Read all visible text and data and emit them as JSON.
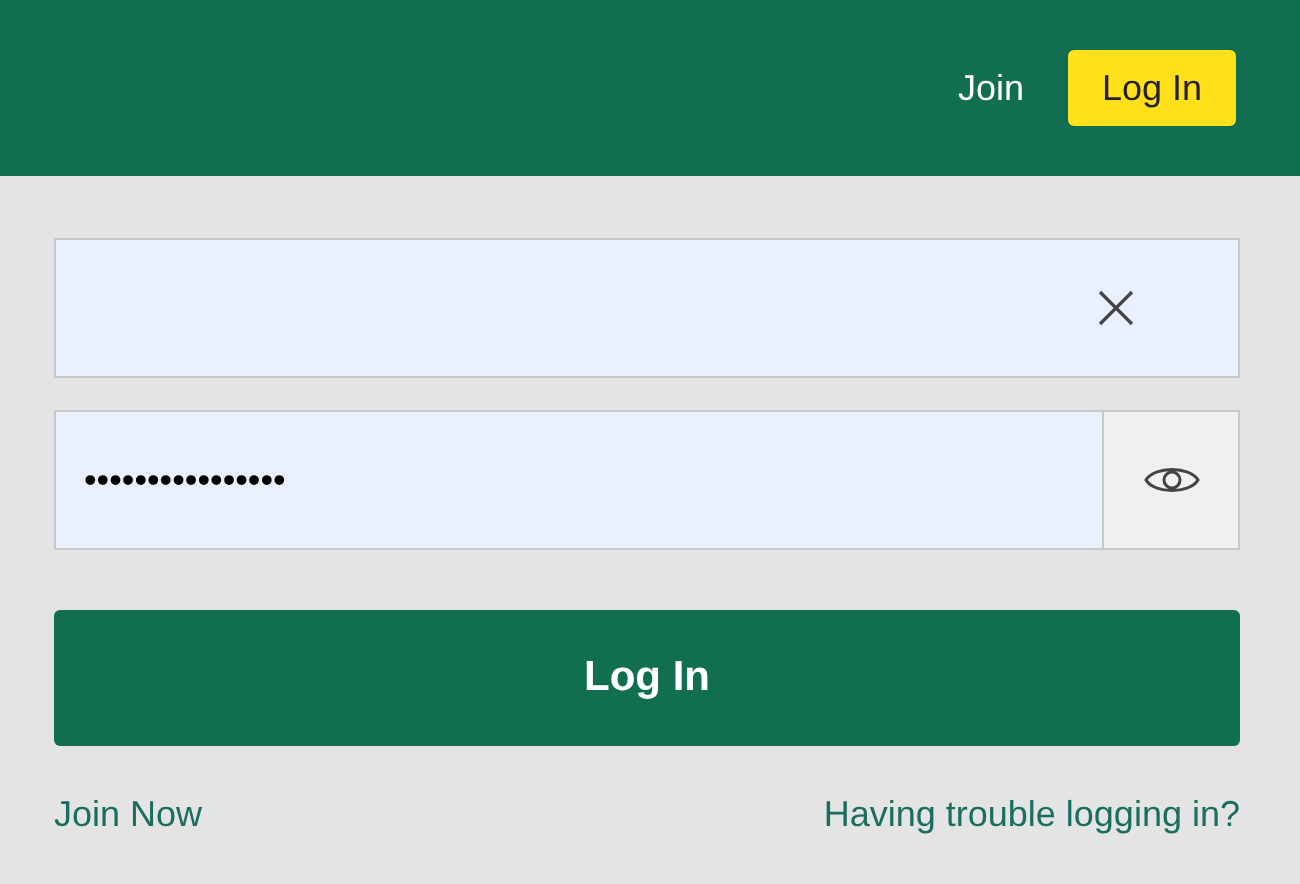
{
  "header": {
    "links": [
      {
        "label": "Join",
        "kind": "link"
      },
      {
        "label": "Log In",
        "kind": "button"
      }
    ]
  },
  "form": {
    "username": {
      "clearable": true
    },
    "password": {
      "value": "••••••••••••••••",
      "revealable": true
    },
    "submit": "Log In",
    "links": [
      "Join Now",
      "Having trouble logging in?"
    ]
  }
}
